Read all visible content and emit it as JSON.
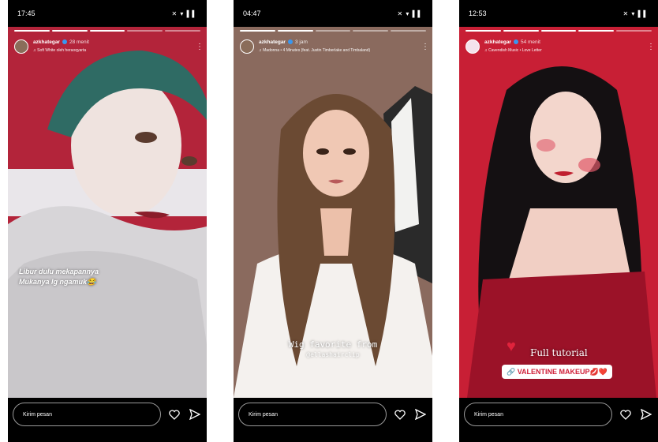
{
  "phones": [
    {
      "status_time": "17:45",
      "status_icons": "✕ ▾ ▌▌",
      "username": "azkhategar",
      "time_ago": "28 menit",
      "music": "Soft White oleh heraoqyarta",
      "caption_line1": "Libur dulu mekapannya",
      "caption_line2": "Mukanya lg ngamuk😂",
      "message_placeholder": "Kirim pesan"
    },
    {
      "status_time": "04:47",
      "status_icons": "✕ ▾ ▌▌",
      "username": "azkhategar",
      "time_ago": "3 jam",
      "music": "Madonna • 4 Minutes (feat. Justin Timberlake and Timbaland)",
      "caption_line1": "Wig favorite from",
      "caption_line2": "@ellashairclip",
      "message_placeholder": "Kirim pesan"
    },
    {
      "status_time": "12:53",
      "status_icons": "✕ ▾ ▌▌",
      "username": "azkhategar",
      "time_ago": "54 menit",
      "music": "Cavendish Music • Love Letter",
      "caption_line1": "Full tutorial",
      "caption_line2": "VALENTINE MAKEUP💋❤️",
      "message_placeholder": "Kirim pesan"
    }
  ]
}
